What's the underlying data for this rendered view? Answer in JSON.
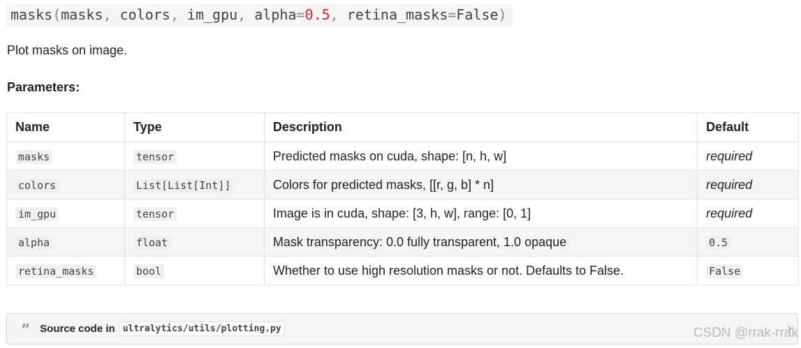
{
  "signature": {
    "name": "masks",
    "open_paren": "(",
    "arg1": "masks",
    "comma": ",",
    "arg2": "colors",
    "arg3": "im_gpu",
    "arg4_name": "alpha",
    "equals": "=",
    "arg4_value": "0.5",
    "arg5_name": "retina_masks",
    "arg5_value": "False",
    "close_paren": ")"
  },
  "summary": "Plot masks on image.",
  "parameters_heading": "Parameters:",
  "table": {
    "headers": [
      "Name",
      "Type",
      "Description",
      "Default"
    ],
    "rows": [
      {
        "name": "masks",
        "type": "tensor",
        "description": "Predicted masks on cuda, shape: [n, h, w]",
        "default": "required"
      },
      {
        "name": "colors",
        "type": "List[List[Int]]",
        "description": "Colors for predicted masks, [[r, g, b] * n]",
        "default": "required"
      },
      {
        "name": "im_gpu",
        "type": "tensor",
        "description": "Image is in cuda, shape: [3, h, w], range: [0, 1]",
        "default": "required"
      },
      {
        "name": "alpha",
        "type": "float",
        "description": "Mask transparency: 0.0 fully transparent, 1.0 opaque",
        "default": "0.5"
      },
      {
        "name": "retina_masks",
        "type": "bool",
        "description": "Whether to use high resolution masks or not. Defaults to False.",
        "default": "False"
      }
    ]
  },
  "source": {
    "icon": "quote-icon",
    "label": "Source code in",
    "path": "ultralytics/utils/plotting.py",
    "chevron_icon": "chevron-right-icon"
  },
  "watermark": "CSDN @rrak-rrak"
}
